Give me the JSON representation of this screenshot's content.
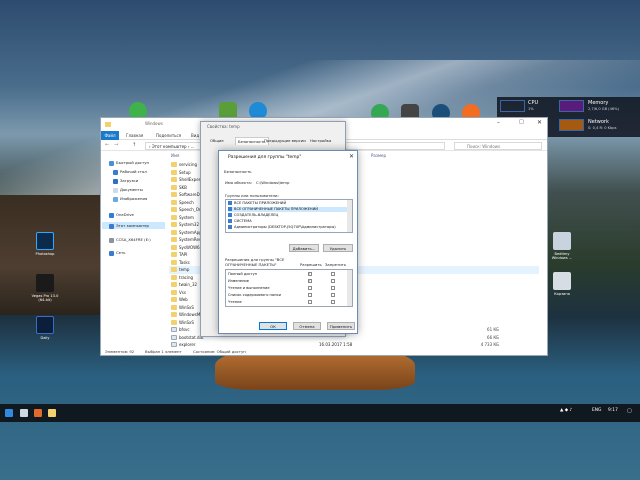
{
  "desktop": {
    "icons": [
      {
        "label": "Photoshop"
      },
      {
        "label": "Vegas Pro 13.0 (64-bit)"
      },
      {
        "label": "Daily"
      },
      {
        "label": "Bedtimy Windows ..."
      },
      {
        "label": "Корзина"
      }
    ]
  },
  "perf_widget": {
    "cpu_label": "CPU",
    "cpu_value": "1%",
    "memory_label": "Memory",
    "memory_value": "2,7/6,0 GB (46%)",
    "network_label": "Network",
    "network_value": "S: 0,4 R: 0 Kbps"
  },
  "explorer": {
    "title": "Windows",
    "ribbon": {
      "file": "Файл",
      "tabs": [
        "Главная",
        "Поделиться",
        "Вид"
      ]
    },
    "address": "› Этот компьютер › ...",
    "search_placeholder": "Поиск: Windows",
    "nav": [
      {
        "label": "Быстрый доступ"
      },
      {
        "label": "Рабочий стол"
      },
      {
        "label": "Загрузки"
      },
      {
        "label": "Документы"
      },
      {
        "label": "Изображения"
      },
      {
        "label": "OneDrive"
      },
      {
        "label": "Этот компьютер"
      },
      {
        "label": "CCSA_X64FRE (E:)"
      },
      {
        "label": "Сеть"
      }
    ],
    "columns": {
      "name": "Имя",
      "size": "Размер"
    },
    "files": [
      {
        "name": "servicing",
        "size": ""
      },
      {
        "name": "Setup",
        "size": ""
      },
      {
        "name": "ShellExperie...",
        "size": ""
      },
      {
        "name": "SKB",
        "size": ""
      },
      {
        "name": "SoftwareDist...",
        "size": ""
      },
      {
        "name": "Speech",
        "size": ""
      },
      {
        "name": "Speech_One...",
        "size": ""
      },
      {
        "name": "System",
        "size": ""
      },
      {
        "name": "System32",
        "size": ""
      },
      {
        "name": "SystemApps",
        "size": ""
      },
      {
        "name": "SystemReso...",
        "size": ""
      },
      {
        "name": "SysWOW64",
        "size": ""
      },
      {
        "name": "TAPI",
        "size": ""
      },
      {
        "name": "Tasks",
        "size": ""
      },
      {
        "name": "temp",
        "size": ""
      },
      {
        "name": "tracing",
        "size": ""
      },
      {
        "name": "twain_32",
        "size": ""
      },
      {
        "name": "Vss",
        "size": ""
      },
      {
        "name": "Web",
        "size": ""
      },
      {
        "name": "WinSxS",
        "size": ""
      },
      {
        "name": "WindowsManagement...",
        "size": ""
      },
      {
        "name": "WinSxS",
        "size": ""
      },
      {
        "name": "bfsvc",
        "size": "61 КБ"
      },
      {
        "name": "bootstat.dat",
        "size": "66 КБ"
      },
      {
        "name": "explorer",
        "size": "4 733 КБ"
      }
    ],
    "file_date": "16.03.2017 1:58",
    "status": {
      "count": "Элементов: 92",
      "selected": "Выбран 1 элемент",
      "state": "Состояние: Общий доступ"
    }
  },
  "properties_dialog": {
    "title": "Свойства: temp",
    "tabs": [
      "Общие",
      "Безопасность",
      "Предыдущие версии",
      "Настройка"
    ]
  },
  "permissions_dialog": {
    "title": "Разрешения для группы \"temp\"",
    "security_label": "Безопасность",
    "object_label": "Имя объекта:",
    "object_value": "C:\\Windows\\temp",
    "groups_label": "Группы или пользователи:",
    "groups": [
      {
        "name": "ВСЕ ПАКЕТЫ ПРИЛОЖЕНИЙ"
      },
      {
        "name": "ВСЕ ОГРАНИЧЕННЫЕ ПАКЕТЫ ПРИЛОЖЕНИЙ"
      },
      {
        "name": "СОЗДАТЕЛЬ-ВЛАДЕЛЕЦ"
      },
      {
        "name": "СИСТЕМА"
      },
      {
        "name": "Администраторы (DESKTOP-J5Q7UP\\Администраторы)"
      }
    ],
    "add_button": "Добавить...",
    "remove_button": "Удалить",
    "perm_header": "Разрешения для группы \"ВСЕ ОГРАНИЧЕННЫЕ ПАКЕТЫ\"",
    "allow": "Разрешить",
    "deny": "Запретить",
    "permissions": [
      {
        "name": "Полный доступ",
        "allow": true,
        "deny": false
      },
      {
        "name": "Изменение",
        "allow": true,
        "deny": false
      },
      {
        "name": "Чтение и выполнение",
        "allow": false,
        "deny": false
      },
      {
        "name": "Список содержимого папки",
        "allow": false,
        "deny": false
      },
      {
        "name": "Чтение",
        "allow": false,
        "deny": false
      }
    ],
    "ok": "ОК",
    "cancel": "Отмена",
    "apply": "Применить"
  },
  "taskbar": {
    "lang": "ENG",
    "time": "9:17"
  }
}
